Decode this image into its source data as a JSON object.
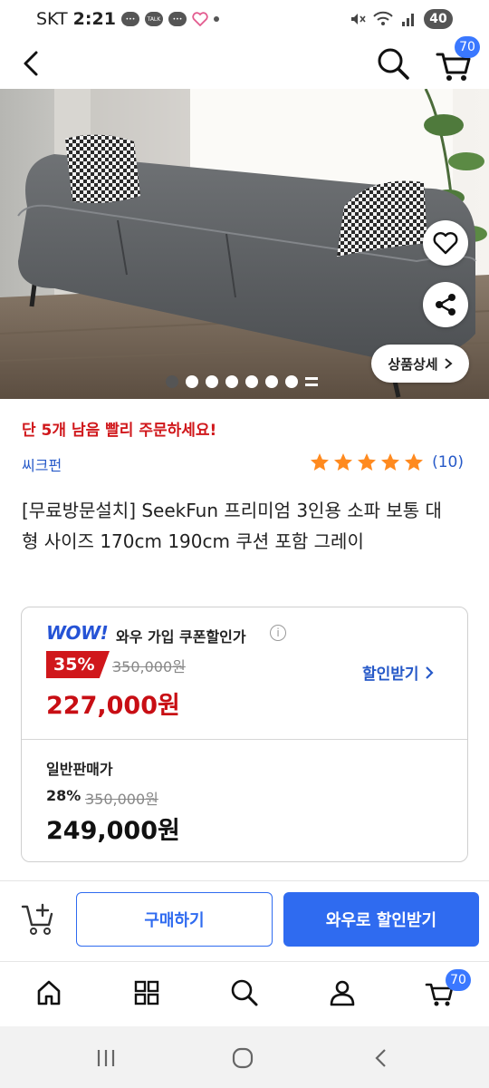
{
  "status_bar": {
    "carrier": "SKT",
    "time": "2:21",
    "talk_label": "TALK",
    "battery": "40"
  },
  "header": {
    "cart_count": "70"
  },
  "hero": {
    "detail_label": "상품상세",
    "pager": {
      "total": 7,
      "current": 1
    }
  },
  "product": {
    "stock_warning": "단 5개 남음 빨리 주문하세요!",
    "seller": "씨크펀",
    "rating_count": "(10)",
    "rating_stars": 5,
    "title": "[무료방문설치] SeekFun 프리미엄 3인용 소파 보통 대형 사이즈 170cm 190cm 쿠션 포함 그레이"
  },
  "price": {
    "wow_logo": "WOW!",
    "wow_label": "와우 가입 쿠폰할인가",
    "info_symbol": "i",
    "discount_rate": "35%",
    "wow_original": "350,000원",
    "wow_price": "227,000원",
    "get_discount": "할인받기",
    "regular_label": "일반판매가",
    "regular_rate": "28%",
    "regular_original": "350,000원",
    "regular_price": "249,000원"
  },
  "actions": {
    "buy": "구매하기",
    "wow_buy": "와우로 할인받기"
  },
  "tabs": {
    "cart_count": "70"
  },
  "colors": {
    "accent_blue": "#2f6bf0",
    "sale_red": "#d0171b",
    "star_orange": "#ff8a1f",
    "badge_blue": "#3a78ff"
  }
}
